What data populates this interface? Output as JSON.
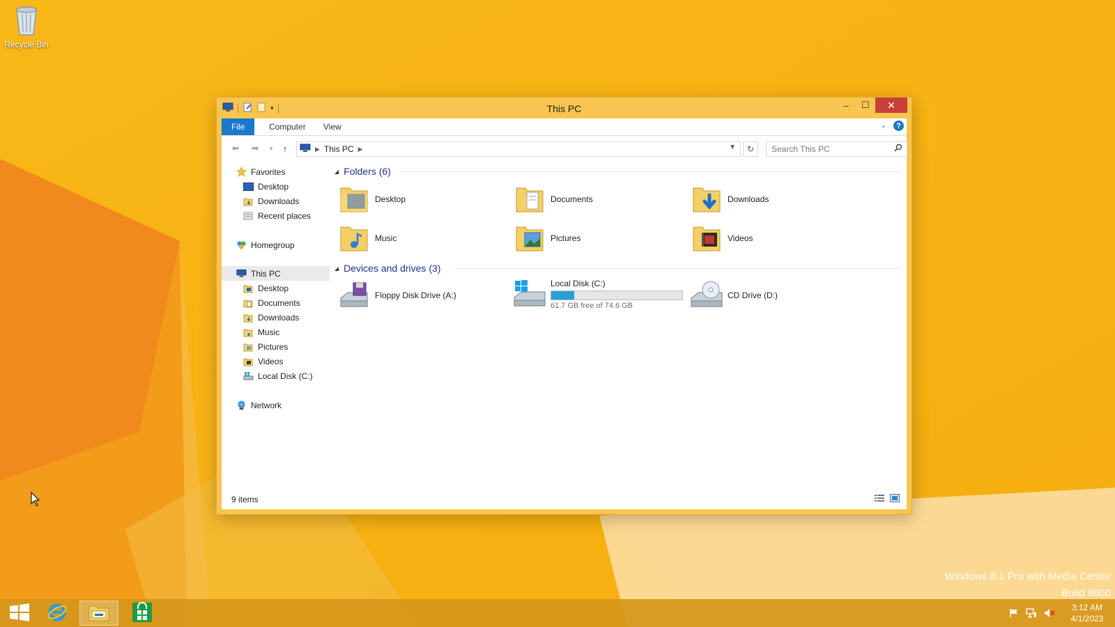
{
  "desktop": {
    "recycle_bin_label": "Recycle Bin",
    "watermark_line1": "Windows 8.1 Pro with Media Center",
    "watermark_line2": "Build 9600"
  },
  "window": {
    "title": "This PC",
    "ribbon_tabs": [
      "File",
      "Computer",
      "View"
    ],
    "address_crumb": "This PC",
    "search_placeholder": "Search This PC"
  },
  "sidebar": {
    "favorites": {
      "label": "Favorites",
      "items": [
        "Desktop",
        "Downloads",
        "Recent places"
      ]
    },
    "homegroup": "Homegroup",
    "this_pc": {
      "label": "This PC",
      "items": [
        "Desktop",
        "Documents",
        "Downloads",
        "Music",
        "Pictures",
        "Videos",
        "Local Disk (C:)"
      ]
    },
    "network": "Network"
  },
  "content": {
    "folders_heading": "Folders (6)",
    "folders": [
      "Desktop",
      "Documents",
      "Downloads",
      "Music",
      "Pictures",
      "Videos"
    ],
    "devices_heading": "Devices and drives (3)",
    "drives": [
      {
        "name": "Floppy Disk Drive (A:)"
      },
      {
        "name": "Local Disk (C:)",
        "free_text": "61.7 GB free of 74.6 GB",
        "used_fraction": 0.173
      },
      {
        "name": "CD Drive (D:)"
      }
    ]
  },
  "status": {
    "item_count": "9 items"
  },
  "taskbar": {
    "time": "3:12 AM",
    "date": "4/1/2023"
  },
  "colors": {
    "accent": "#1979ca",
    "window_frame": "#f7c550",
    "close_button": "#c8403a",
    "drive_bar": "#26a0da"
  }
}
